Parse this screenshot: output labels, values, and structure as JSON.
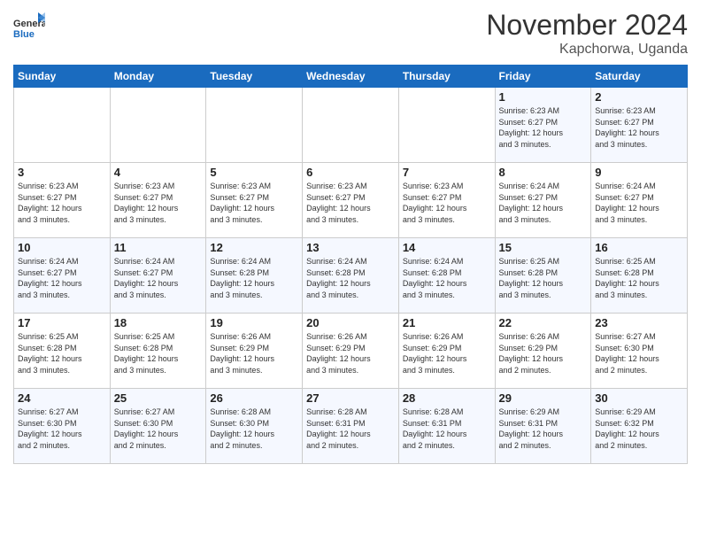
{
  "logo": {
    "general": "General",
    "blue": "Blue"
  },
  "title": "November 2024",
  "location": "Kapchorwa, Uganda",
  "days_of_week": [
    "Sunday",
    "Monday",
    "Tuesday",
    "Wednesday",
    "Thursday",
    "Friday",
    "Saturday"
  ],
  "weeks": [
    [
      {
        "day": "",
        "info": ""
      },
      {
        "day": "",
        "info": ""
      },
      {
        "day": "",
        "info": ""
      },
      {
        "day": "",
        "info": ""
      },
      {
        "day": "",
        "info": ""
      },
      {
        "day": "1",
        "info": "Sunrise: 6:23 AM\nSunset: 6:27 PM\nDaylight: 12 hours\nand 3 minutes."
      },
      {
        "day": "2",
        "info": "Sunrise: 6:23 AM\nSunset: 6:27 PM\nDaylight: 12 hours\nand 3 minutes."
      }
    ],
    [
      {
        "day": "3",
        "info": "Sunrise: 6:23 AM\nSunset: 6:27 PM\nDaylight: 12 hours\nand 3 minutes."
      },
      {
        "day": "4",
        "info": "Sunrise: 6:23 AM\nSunset: 6:27 PM\nDaylight: 12 hours\nand 3 minutes."
      },
      {
        "day": "5",
        "info": "Sunrise: 6:23 AM\nSunset: 6:27 PM\nDaylight: 12 hours\nand 3 minutes."
      },
      {
        "day": "6",
        "info": "Sunrise: 6:23 AM\nSunset: 6:27 PM\nDaylight: 12 hours\nand 3 minutes."
      },
      {
        "day": "7",
        "info": "Sunrise: 6:23 AM\nSunset: 6:27 PM\nDaylight: 12 hours\nand 3 minutes."
      },
      {
        "day": "8",
        "info": "Sunrise: 6:24 AM\nSunset: 6:27 PM\nDaylight: 12 hours\nand 3 minutes."
      },
      {
        "day": "9",
        "info": "Sunrise: 6:24 AM\nSunset: 6:27 PM\nDaylight: 12 hours\nand 3 minutes."
      }
    ],
    [
      {
        "day": "10",
        "info": "Sunrise: 6:24 AM\nSunset: 6:27 PM\nDaylight: 12 hours\nand 3 minutes."
      },
      {
        "day": "11",
        "info": "Sunrise: 6:24 AM\nSunset: 6:27 PM\nDaylight: 12 hours\nand 3 minutes."
      },
      {
        "day": "12",
        "info": "Sunrise: 6:24 AM\nSunset: 6:28 PM\nDaylight: 12 hours\nand 3 minutes."
      },
      {
        "day": "13",
        "info": "Sunrise: 6:24 AM\nSunset: 6:28 PM\nDaylight: 12 hours\nand 3 minutes."
      },
      {
        "day": "14",
        "info": "Sunrise: 6:24 AM\nSunset: 6:28 PM\nDaylight: 12 hours\nand 3 minutes."
      },
      {
        "day": "15",
        "info": "Sunrise: 6:25 AM\nSunset: 6:28 PM\nDaylight: 12 hours\nand 3 minutes."
      },
      {
        "day": "16",
        "info": "Sunrise: 6:25 AM\nSunset: 6:28 PM\nDaylight: 12 hours\nand 3 minutes."
      }
    ],
    [
      {
        "day": "17",
        "info": "Sunrise: 6:25 AM\nSunset: 6:28 PM\nDaylight: 12 hours\nand 3 minutes."
      },
      {
        "day": "18",
        "info": "Sunrise: 6:25 AM\nSunset: 6:28 PM\nDaylight: 12 hours\nand 3 minutes."
      },
      {
        "day": "19",
        "info": "Sunrise: 6:26 AM\nSunset: 6:29 PM\nDaylight: 12 hours\nand 3 minutes."
      },
      {
        "day": "20",
        "info": "Sunrise: 6:26 AM\nSunset: 6:29 PM\nDaylight: 12 hours\nand 3 minutes."
      },
      {
        "day": "21",
        "info": "Sunrise: 6:26 AM\nSunset: 6:29 PM\nDaylight: 12 hours\nand 3 minutes."
      },
      {
        "day": "22",
        "info": "Sunrise: 6:26 AM\nSunset: 6:29 PM\nDaylight: 12 hours\nand 2 minutes."
      },
      {
        "day": "23",
        "info": "Sunrise: 6:27 AM\nSunset: 6:30 PM\nDaylight: 12 hours\nand 2 minutes."
      }
    ],
    [
      {
        "day": "24",
        "info": "Sunrise: 6:27 AM\nSunset: 6:30 PM\nDaylight: 12 hours\nand 2 minutes."
      },
      {
        "day": "25",
        "info": "Sunrise: 6:27 AM\nSunset: 6:30 PM\nDaylight: 12 hours\nand 2 minutes."
      },
      {
        "day": "26",
        "info": "Sunrise: 6:28 AM\nSunset: 6:30 PM\nDaylight: 12 hours\nand 2 minutes."
      },
      {
        "day": "27",
        "info": "Sunrise: 6:28 AM\nSunset: 6:31 PM\nDaylight: 12 hours\nand 2 minutes."
      },
      {
        "day": "28",
        "info": "Sunrise: 6:28 AM\nSunset: 6:31 PM\nDaylight: 12 hours\nand 2 minutes."
      },
      {
        "day": "29",
        "info": "Sunrise: 6:29 AM\nSunset: 6:31 PM\nDaylight: 12 hours\nand 2 minutes."
      },
      {
        "day": "30",
        "info": "Sunrise: 6:29 AM\nSunset: 6:32 PM\nDaylight: 12 hours\nand 2 minutes."
      }
    ]
  ]
}
